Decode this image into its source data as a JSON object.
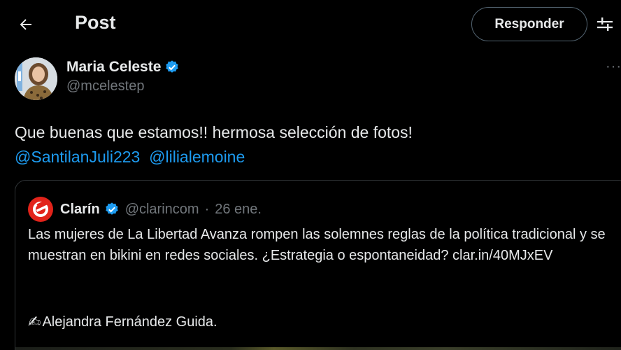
{
  "header": {
    "title": "Post",
    "reply_label": "Responder"
  },
  "post": {
    "author_name": "Maria Celeste",
    "handle": "@mcelestep",
    "text": "Que buenas que estamos!!  hermosa selección de fotos!",
    "mentions": [
      "@SantilanJuli223",
      "@lilialemoine"
    ]
  },
  "quote": {
    "author_name": "Clarín",
    "handle": "@clarincom",
    "dot": "·",
    "date": "26 ene.",
    "body": "Las mujeres de La Libertad Avanza rompen las solemnes reglas de la política tradicional y se muestran en bikini en redes sociales. ¿Estrategia o espontaneidad? clar.in/40MJxEV",
    "signature": "Alejandra Fernández Guida."
  },
  "colors": {
    "background": "#000000",
    "text": "#e7e9ea",
    "muted": "#71767b",
    "accent": "#1d9bf0",
    "border": "#2f3336",
    "verified": "#1d9bf0",
    "brand_clarin": "#e2231a"
  },
  "icons": {
    "back": "arrow-left-icon",
    "filter": "sliders-icon",
    "verified": "verified-badge-icon",
    "more": "more-horizontal-icon",
    "writing_hand": "writing-hand-icon"
  }
}
